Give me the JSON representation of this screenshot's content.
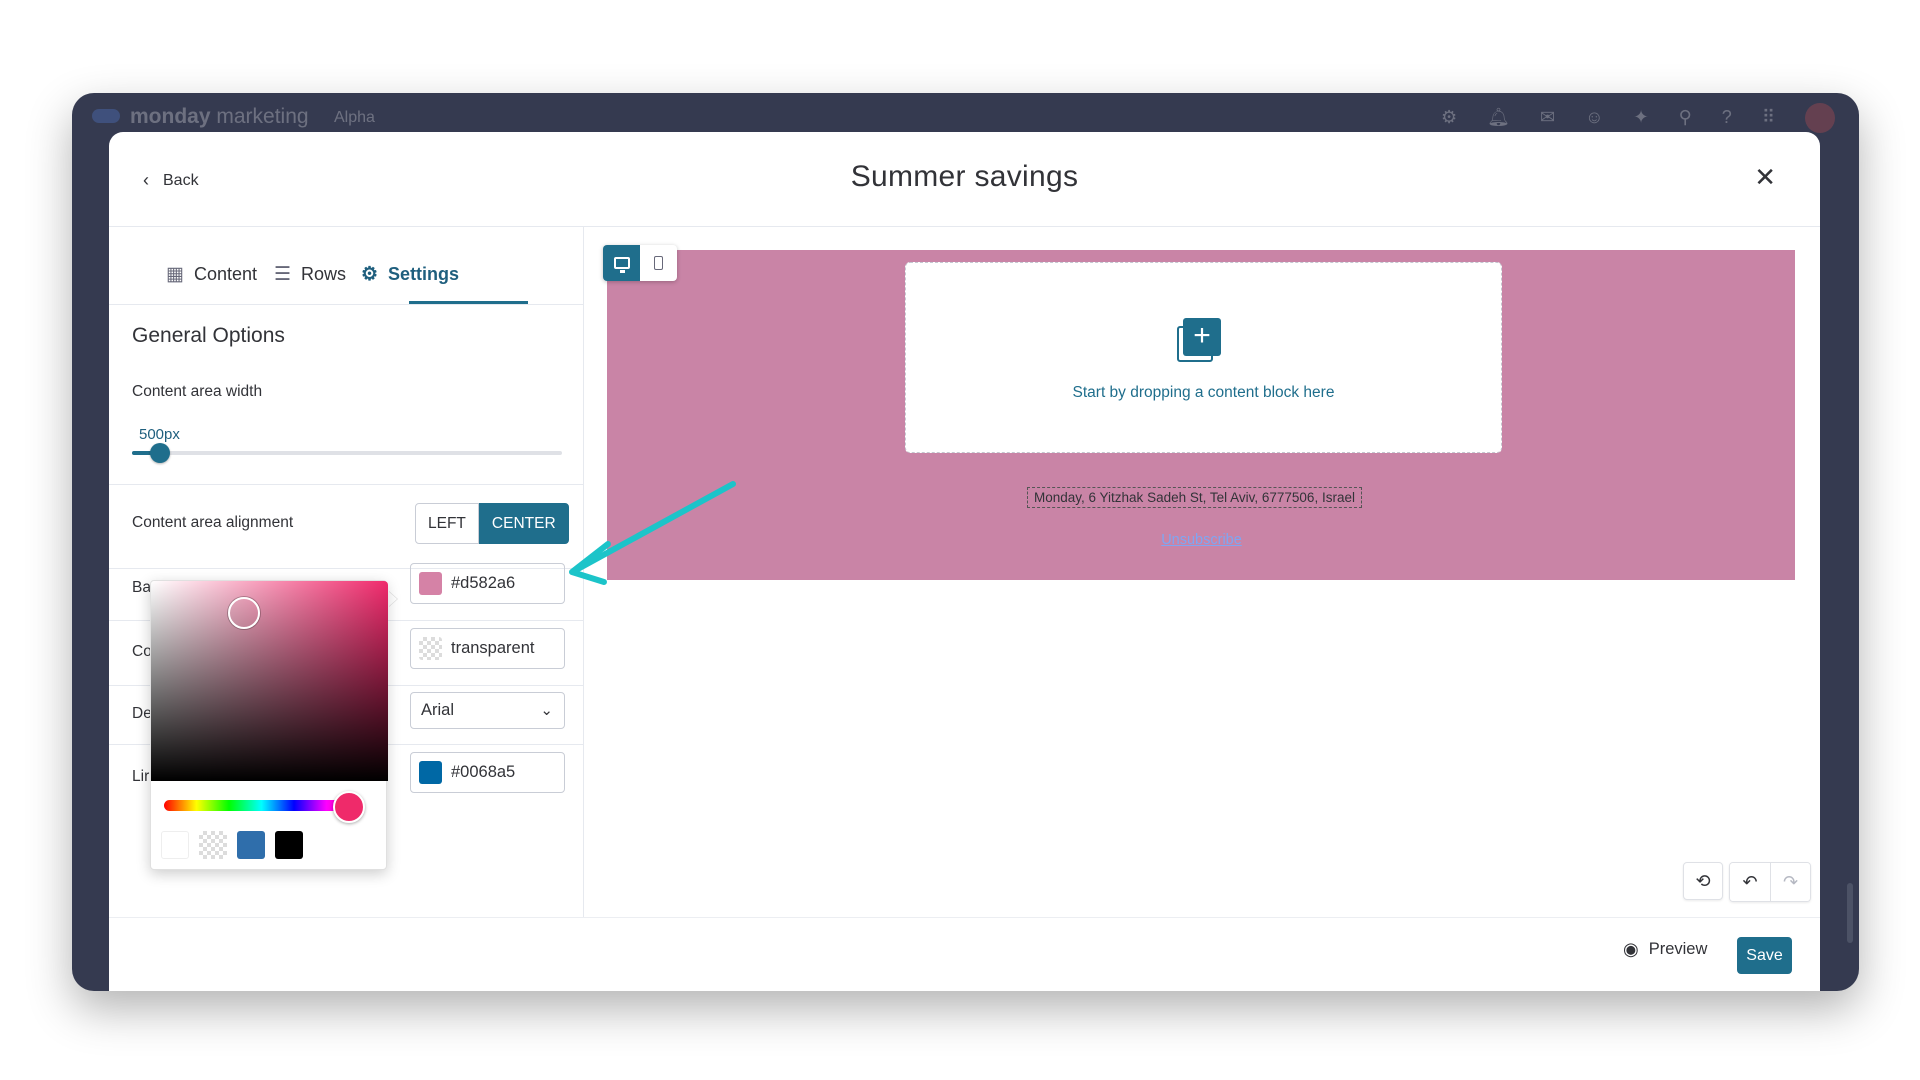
{
  "app": {
    "brand": "monday",
    "product": "marketing",
    "tag": "Alpha",
    "topbar_icons": [
      "settings-icon",
      "bell-icon",
      "inbox-icon",
      "people-icon",
      "puzzle-icon",
      "search-icon",
      "help-icon",
      "apps-icon"
    ]
  },
  "modal": {
    "back_label": "Back",
    "title": "Summer savings",
    "close_icon": "close-icon"
  },
  "tabs": [
    {
      "label": "Content",
      "icon": "grid-icon",
      "active": false
    },
    {
      "label": "Rows",
      "icon": "rows-icon",
      "active": false
    },
    {
      "label": "Settings",
      "icon": "gear-icon",
      "active": true
    }
  ],
  "settings": {
    "section_title": "General Options",
    "width_label": "Content area width",
    "width_value": "500px",
    "width_fraction": 0.065,
    "alignment_label": "Content area alignment",
    "alignment_options": [
      "LEFT",
      "CENTER"
    ],
    "alignment_selected": "CENTER",
    "background_label_visible": "Ba",
    "background_color": "#d582a6",
    "content_bg_label_visible": "Co",
    "content_bg_value": "transparent",
    "font_label_visible": "De",
    "font_value": "Arial",
    "link_label_visible": "Lir",
    "link_color": "#0068a5"
  },
  "color_picker": {
    "hue_color": "#ef2a6a",
    "hue_fraction": 0.95,
    "presets": [
      {
        "name": "white",
        "color": "#ffffff"
      },
      {
        "name": "transparent",
        "color": "transparent"
      },
      {
        "name": "blue",
        "color": "#2f6eab"
      },
      {
        "name": "black",
        "color": "#000000"
      }
    ]
  },
  "preview": {
    "canvas_color": "#c984a6",
    "drop_text": "Start by dropping a content block here",
    "address": "Monday, 6 Yitzhak Sadeh St, Tel Aviv, 6777506, Israel",
    "unsubscribe": "Unsubscribe"
  },
  "footer": {
    "preview_label": "Preview",
    "save_label": "Save"
  },
  "colors": {
    "accent": "#1f6e8c",
    "annotation_arrow": "#1cc4c9",
    "frame": "#353a50"
  }
}
